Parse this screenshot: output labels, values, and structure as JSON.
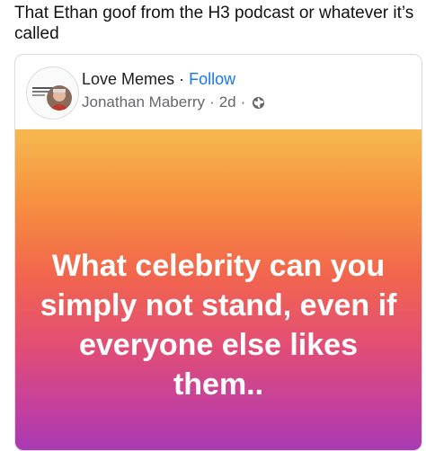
{
  "comment": {
    "text": "That Ethan goof from the H3 podcast or whatever it’s called"
  },
  "post": {
    "page_name": "Love Memes",
    "separator": "·",
    "follow_label": "Follow",
    "author": "Jonathan Maberry",
    "time": "2d",
    "privacy_icon": "globe-icon",
    "banner_text": "What celebrity can you simply not stand, even if everyone else likes them..",
    "banner_colors": [
      "#f6b94e",
      "#f7913f",
      "#f2664c",
      "#e24d76",
      "#c13fa0",
      "#a83bb4"
    ],
    "follow_color": "#1877f2"
  }
}
